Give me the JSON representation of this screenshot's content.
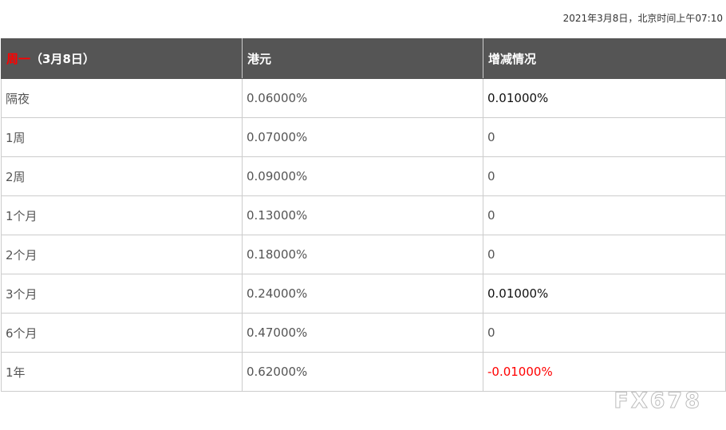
{
  "timestamp": "2021年3月8日，北京时间上午07:10",
  "table": {
    "header": {
      "col1_highlight": "周一",
      "col1_rest": "（3月8日）",
      "col2": "港元",
      "col3": "增减情况"
    },
    "rows": [
      {
        "term": "隔夜",
        "rate": "0.06000%",
        "change": "0.01000%"
      },
      {
        "term": "1周",
        "rate": "0.07000%",
        "change": "0"
      },
      {
        "term": "2周",
        "rate": "0.09000%",
        "change": "0"
      },
      {
        "term": "1个月",
        "rate": "0.13000%",
        "change": "0"
      },
      {
        "term": "2个月",
        "rate": "0.18000%",
        "change": "0"
      },
      {
        "term": "3个月",
        "rate": "0.24000%",
        "change": "0.01000%"
      },
      {
        "term": "6个月",
        "rate": "0.47000%",
        "change": "0"
      },
      {
        "term": "1年",
        "rate": "0.62000%",
        "change": "-0.01000%"
      }
    ]
  },
  "watermark": "FX678",
  "colors": {
    "header_bg": "#555555",
    "highlight_red": "#ff0000",
    "positive_change": "#111111",
    "negative_change": "#ff0000",
    "neutral_text": "#555555"
  }
}
